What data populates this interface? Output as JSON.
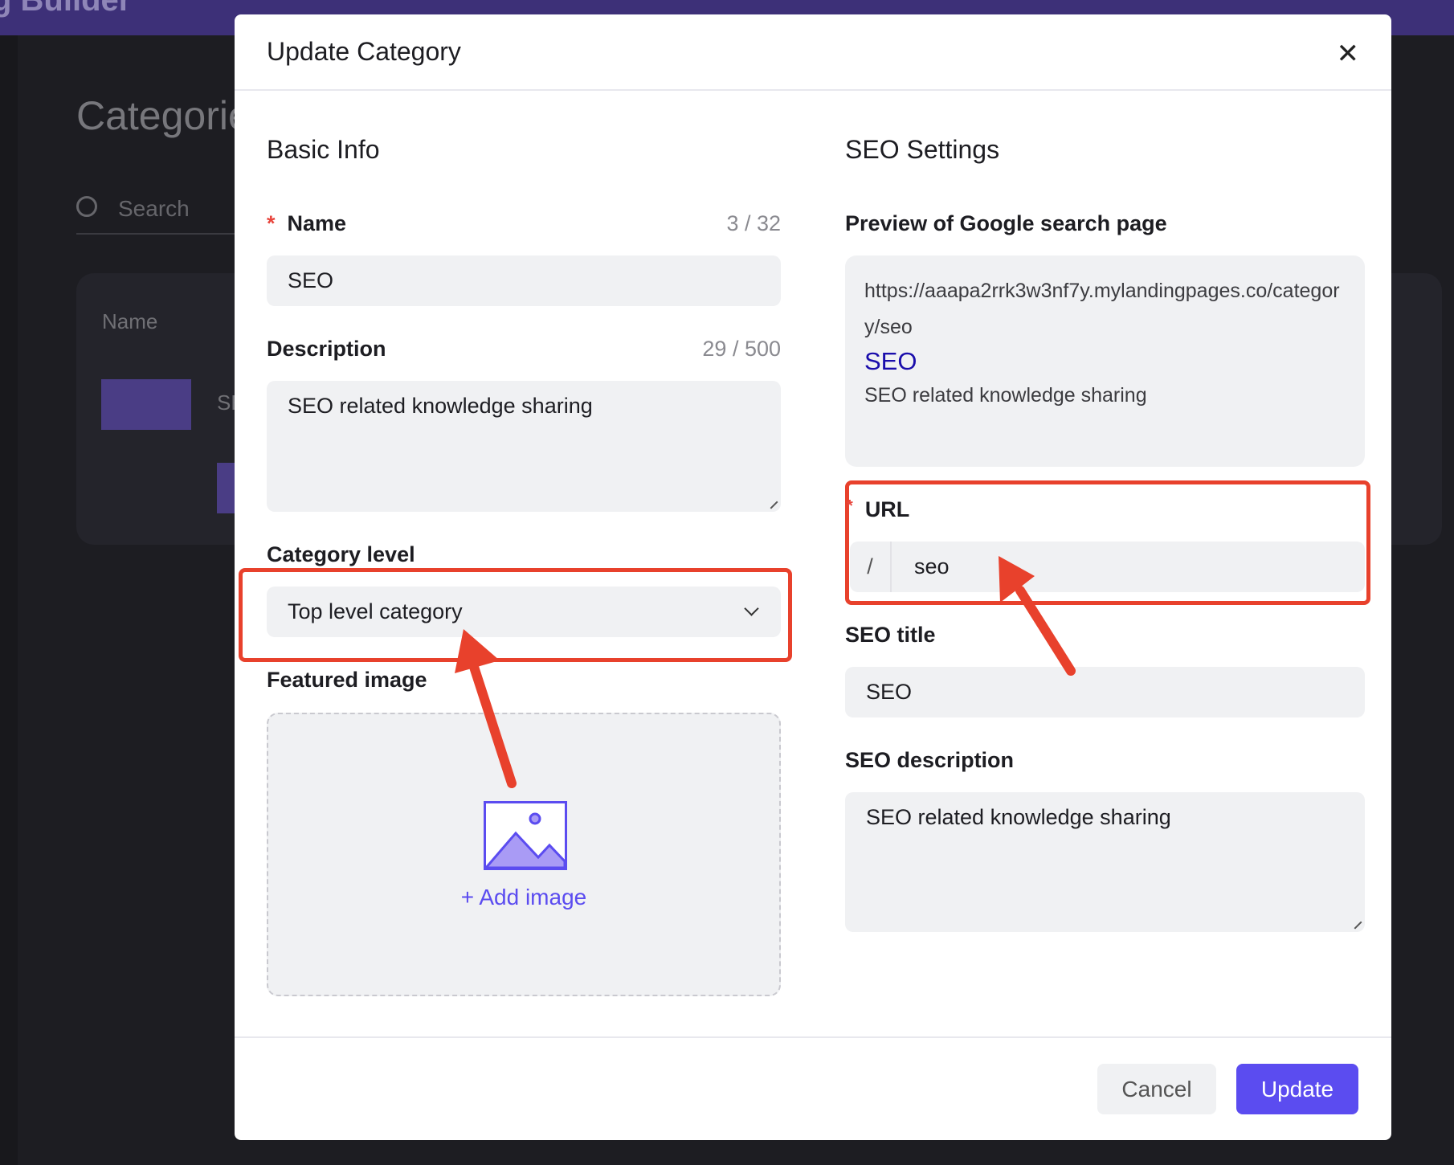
{
  "background": {
    "app_title": "g Builder",
    "page_title": "Categories",
    "search_placeholder": "Search",
    "table_header_name": "Name",
    "row_name_partial": "SE"
  },
  "modal": {
    "title": "Update Category",
    "close_icon": "close-icon",
    "basic_info": {
      "heading": "Basic Info",
      "name_label": "Name",
      "name_required": "*",
      "name_count": "3 / 32",
      "name_value": "SEO",
      "description_label": "Description",
      "description_count": "29 / 500",
      "description_value": "SEO related knowledge sharing",
      "category_level_label": "Category level",
      "category_level_value": "Top level category",
      "featured_image_label": "Featured image",
      "add_image_label": "+ Add image"
    },
    "seo": {
      "heading": "SEO Settings",
      "preview_label": "Preview of Google search page",
      "preview_url": "https://aaapa2rrk3w3nf7y.mylandingpages.co/category/seo",
      "preview_title": "SEO",
      "preview_description": "SEO related knowledge sharing",
      "url_label": "URL",
      "url_required": "*",
      "url_prefix": "/",
      "url_value": "seo",
      "seo_title_label": "SEO title",
      "seo_title_value": "SEO",
      "seo_description_label": "SEO description",
      "seo_description_value": "SEO related knowledge sharing"
    },
    "footer": {
      "cancel_label": "Cancel",
      "update_label": "Update"
    }
  },
  "colors": {
    "accent": "#5b4cf0",
    "annotation": "#e8412c",
    "preview_title": "#1a0dab"
  }
}
